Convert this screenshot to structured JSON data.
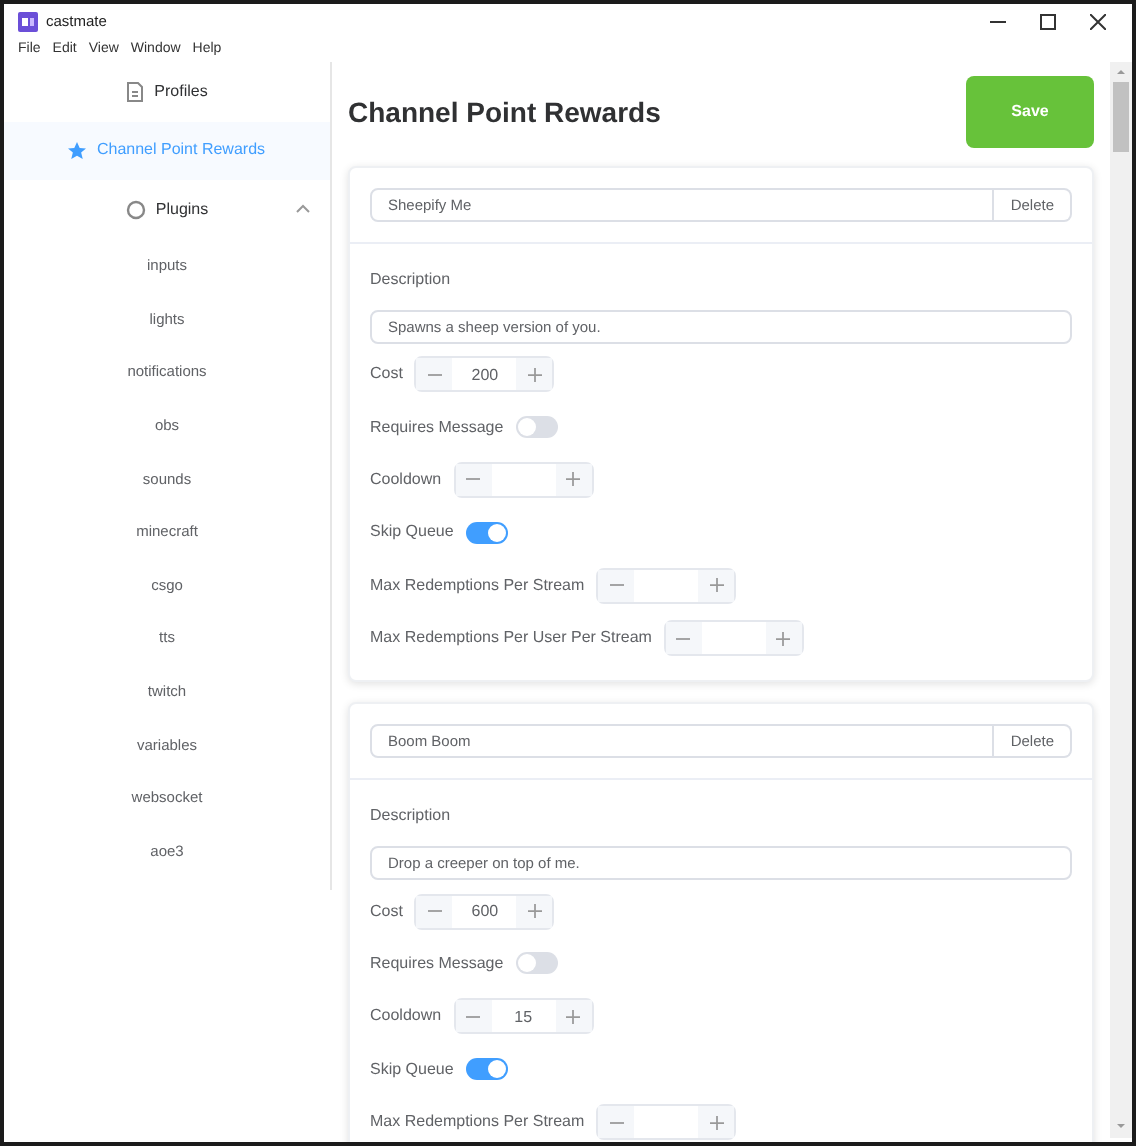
{
  "window": {
    "title": "castmate"
  },
  "menu": [
    "File",
    "Edit",
    "View",
    "Window",
    "Help"
  ],
  "sidebar": {
    "items": [
      {
        "label": "Profiles",
        "kind": "page",
        "selected": false
      },
      {
        "label": "Channel Point Rewards",
        "kind": "page",
        "selected": true
      },
      {
        "label": "Plugins",
        "kind": "group",
        "selected": false,
        "expanded": true,
        "children": [
          {
            "label": "inputs"
          },
          {
            "label": "lights"
          },
          {
            "label": "notifications"
          },
          {
            "label": "obs"
          },
          {
            "label": "sounds"
          },
          {
            "label": "minecraft"
          },
          {
            "label": "csgo"
          },
          {
            "label": "tts"
          },
          {
            "label": "twitch"
          },
          {
            "label": "variables"
          },
          {
            "label": "websocket"
          },
          {
            "label": "aoe3"
          }
        ]
      }
    ]
  },
  "page": {
    "title": "Channel Point Rewards",
    "save_button": "Save"
  },
  "rewards": [
    {
      "name": "Sheepify Me",
      "delete_button": "Delete",
      "description_label": "Description",
      "description": "Spawns a sheep version of you.",
      "rows": [
        {
          "kind": "stepper",
          "label": "Cost",
          "value": "200"
        },
        {
          "kind": "toggle",
          "label": "Requires Message",
          "on": false
        },
        {
          "kind": "stepper",
          "label": "Cooldown"
        },
        {
          "kind": "toggle",
          "label": "Skip Queue",
          "on": true
        },
        {
          "kind": "stepper",
          "label": "Max Redemptions Per Stream"
        },
        {
          "kind": "stepper",
          "label": "Max Redemptions Per User Per Stream"
        }
      ]
    },
    {
      "name": "Boom Boom",
      "delete_button": "Delete",
      "description_label": "Description",
      "description": "Drop a creeper on top of me.",
      "rows": [
        {
          "kind": "stepper",
          "label": "Cost",
          "value": "600"
        },
        {
          "kind": "toggle",
          "label": "Requires Message",
          "on": false
        },
        {
          "kind": "stepper",
          "label": "Cooldown",
          "value": "15"
        },
        {
          "kind": "toggle",
          "label": "Skip Queue",
          "on": true
        },
        {
          "kind": "stepper",
          "label": "Max Redemptions Per Stream"
        }
      ]
    }
  ]
}
